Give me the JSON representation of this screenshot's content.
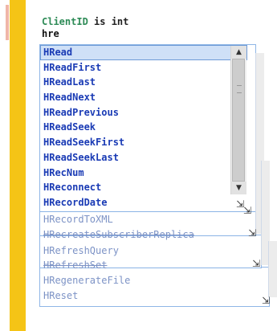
{
  "editor": {
    "line1_identifier": "ClientID",
    "line1_rest": " is int",
    "line2_typed": "hre"
  },
  "autocomplete": {
    "items": [
      "HRead",
      "HReadFirst",
      "HReadLast",
      "HReadNext",
      "HReadPrevious",
      "HReadSeek",
      "HReadSeekFirst",
      "HReadSeekLast",
      "HRecNum",
      "HReconnect",
      "HRecordDate"
    ],
    "selected_index": 0,
    "ghost_items": [
      "HRecordToXML",
      "HRecreateSubscriberReplica",
      "HRefreshQuery",
      "HRefreshSet",
      "HRegenerateFile",
      "HReset"
    ],
    "scroll_up_icon": "▲",
    "scroll_down_icon": "▼",
    "resize_icon": "⇲"
  },
  "colors": {
    "gutter": "#f5c416",
    "list_text": "#1a3bb5",
    "ghost_text": "#7d93c6",
    "selection": "#cfe0f7",
    "identifier": "#2e8b57"
  }
}
